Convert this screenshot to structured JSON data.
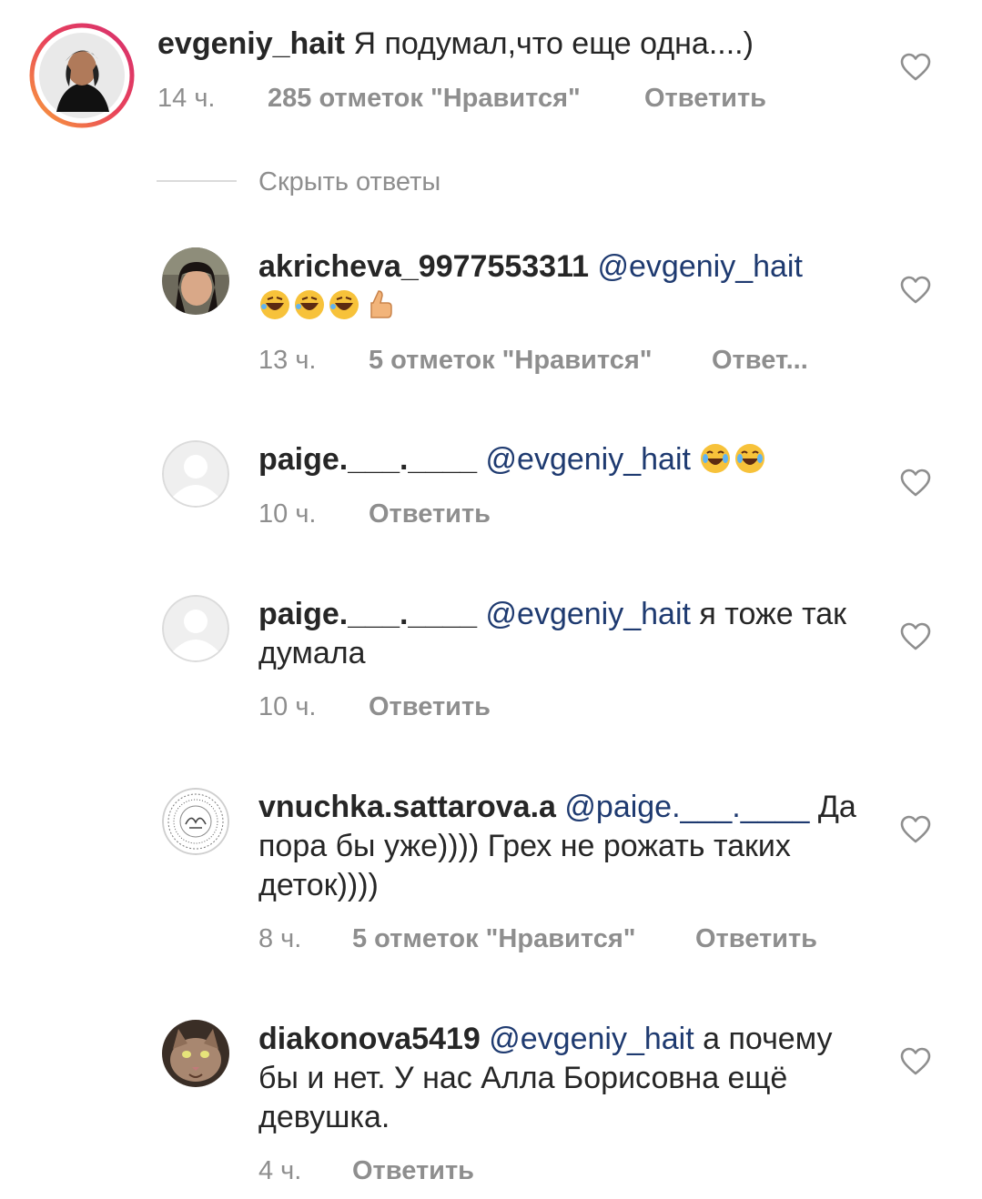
{
  "comments": [
    {
      "username": "evgeniy_hait",
      "mention": "",
      "text": "Я подумал,что еще одна....)",
      "time": "14 ч.",
      "likes": "285 отметок \"Нравится\"",
      "reply": "Ответить",
      "avatar": "photo-avatar-story-ring"
    },
    {
      "username": "akricheva_9977553311",
      "mention": "@evgeniy_hait",
      "text": "🤣🤣🤣👍",
      "time": "13 ч.",
      "likes": "5 отметок \"Нравится\"",
      "reply": "Ответ...",
      "avatar": "photo-avatar"
    },
    {
      "username": "paige.___.____",
      "mention": "@evgeniy_hait",
      "text": "😂😂",
      "time": "10 ч.",
      "likes": "",
      "reply": "Ответить",
      "avatar": "default-avatar"
    },
    {
      "username": "paige.___.____",
      "mention": "@evgeniy_hait",
      "text": "я тоже так думала",
      "time": "10 ч.",
      "likes": "",
      "reply": "Ответить",
      "avatar": "default-avatar"
    },
    {
      "username": "vnuchka.sattarova.a",
      "mention": "@paige.___.____",
      "text": "Да пора бы уже)))) Грех не рожать таких деток))))",
      "time": "8 ч.",
      "likes": "5 отметок \"Нравится\"",
      "reply": "Ответить",
      "avatar": "calligraphy-avatar"
    },
    {
      "username": "diakonova5419",
      "mention": "@evgeniy_hait",
      "text": "а почему бы и нет. У нас Алла Борисовна ещё девушка.",
      "time": "4 ч.",
      "likes": "",
      "reply": "Ответить",
      "avatar": "cat-photo-avatar"
    }
  ],
  "hide_replies": "Скрыть ответы",
  "colors": {
    "text": "#262626",
    "meta": "#8e8e8e",
    "mention": "#1e3a70",
    "divider": "#dbdbdb"
  },
  "icons": [
    "heart-icon"
  ]
}
